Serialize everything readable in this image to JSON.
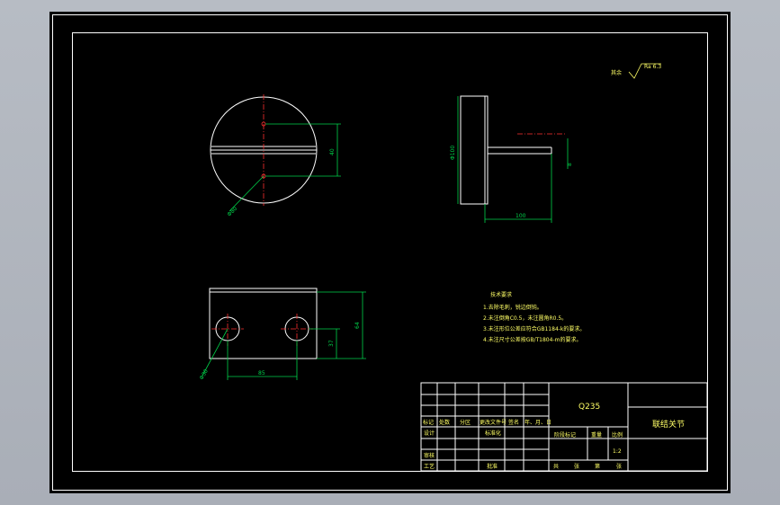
{
  "roughness_note": {
    "label": "其余",
    "value": "Ra 6.3"
  },
  "top_view": {
    "dim_height": "40",
    "dim_diameter": "Φ80"
  },
  "side_view": {
    "dim_diameter": "Φ100",
    "dim_length": "100",
    "dim_small": "8"
  },
  "front_view": {
    "dim_height": "64",
    "dim_hole_center": "37",
    "dim_spacing": "85",
    "dim_hole_diameter": "Φ30"
  },
  "tech_requirements": {
    "title": "技术要求",
    "items": [
      "1.去除毛刺，锐边倒钝。",
      "2.未注倒角C0.5，未注圆角R0.5。",
      "3.未注形位公差应符合GB1184-k的要求。",
      "4.未注尺寸公差按GB/T1804-m的要求。"
    ]
  },
  "title_block": {
    "material": "Q235",
    "part_name": "联结关节",
    "scale_value": "1:2",
    "row_headers": [
      "标记",
      "处数",
      "分区",
      "更改文件号",
      "签名",
      "年、月、日"
    ],
    "left_labels": [
      "设计",
      "标准化",
      "审核",
      "工艺",
      "批准"
    ],
    "stage_header": "阶段标记",
    "weight_header": "重量",
    "scale_header": "比例",
    "sheet_labels": [
      "共",
      "张",
      "第",
      "张"
    ]
  },
  "colors": {
    "background": "#000000",
    "outline": "#ffffff",
    "dimension": "#00d24a",
    "centerline": "#ff3030",
    "text": "#ffff66"
  }
}
